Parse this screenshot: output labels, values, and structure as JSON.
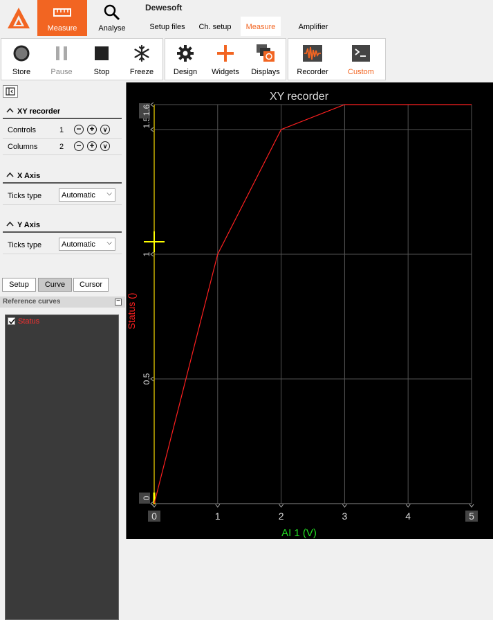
{
  "app": {
    "title": "Dewesoft"
  },
  "modes": [
    {
      "label": "Measure",
      "icon": "ruler-icon",
      "active": true
    },
    {
      "label": "Analyse",
      "icon": "magnifier-icon",
      "active": false
    }
  ],
  "tabs": [
    {
      "label": "Setup files",
      "active": false
    },
    {
      "label": "Ch. setup",
      "active": false
    },
    {
      "label": "Measure",
      "active": true
    },
    {
      "label": "Amplifier",
      "active": false
    }
  ],
  "toolbar": {
    "store": "Store",
    "pause": "Pause",
    "stop": "Stop",
    "freeze": "Freeze",
    "design": "Design",
    "widgets": "Widgets",
    "displays": "Displays",
    "recorder": "Recorder",
    "custom": "Custom"
  },
  "panel": {
    "xy_header": "XY recorder",
    "controls_label": "Controls",
    "controls_value": "1",
    "columns_label": "Columns",
    "columns_value": "2",
    "xaxis_header": "X Axis",
    "xaxis_ticks_label": "Ticks type",
    "xaxis_ticks_value": "Automatic",
    "yaxis_header": "Y Axis",
    "yaxis_ticks_label": "Ticks type",
    "yaxis_ticks_value": "Automatic",
    "subtabs": [
      "Setup",
      "Curve",
      "Cursor"
    ],
    "ref_header": "Reference curves",
    "ref_items": [
      {
        "label": "Status",
        "checked": true
      }
    ]
  },
  "colors": {
    "accent": "#f26522",
    "curve": "#ff2020",
    "xlabel": "#22dd22",
    "cursor": "#ffff00"
  },
  "chart_data": {
    "type": "line",
    "title": "XY recorder",
    "xlabel": "AI 1 (V)",
    "ylabel": "Status ()",
    "xlim": [
      0,
      5
    ],
    "ylim": [
      0,
      1.6
    ],
    "x_ticks": [
      "0",
      "1",
      "2",
      "3",
      "4",
      "5"
    ],
    "y_ticks": [
      "0",
      "0.5",
      "1",
      "1.5",
      "1.6"
    ],
    "grid": true,
    "series": [
      {
        "name": "Status",
        "x": [
          0,
          1,
          2,
          3,
          5
        ],
        "y": [
          0,
          1,
          1.5,
          1.6,
          1.6
        ]
      }
    ],
    "cursor": {
      "x": 0,
      "y": 1.05
    }
  }
}
